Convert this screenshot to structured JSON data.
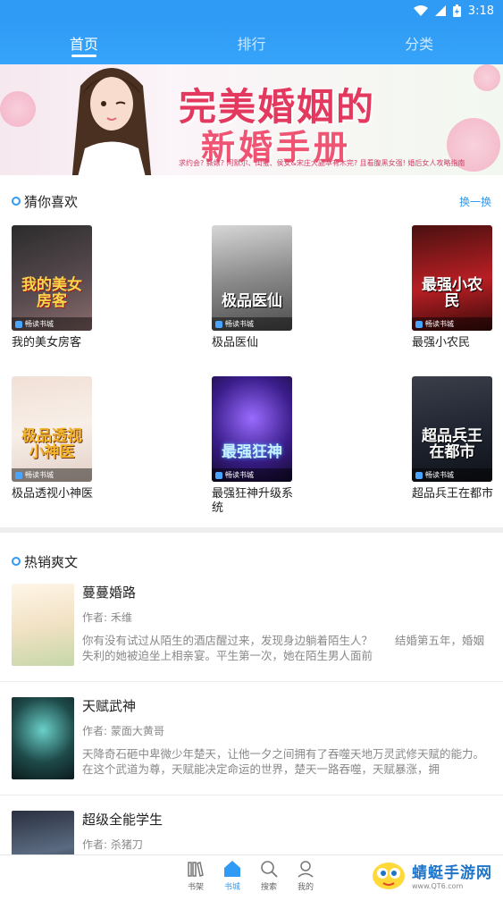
{
  "status_bar": {
    "time": "3:18"
  },
  "top_tabs": [
    {
      "label": "首页",
      "active": true
    },
    {
      "label": "排行",
      "active": false
    },
    {
      "label": "分类",
      "active": false
    }
  ],
  "banner": {
    "title_line1": "完美婚姻的",
    "title_line2": "新婚手册",
    "subtitle": "求约会? 撕婊? 阿默尔、闺蜜、侯女&宋庄大副本有木完? 且看腹黑女强! 婚后女人攻略指南"
  },
  "guess": {
    "title": "猜你喜欢",
    "refresh": "换一换",
    "brand": "畅读书城",
    "books": [
      {
        "name": "我的美女房客",
        "cover_text": "我的美女房客"
      },
      {
        "name": "极品医仙",
        "cover_text": "极品医仙"
      },
      {
        "name": "最强小农民",
        "cover_text": "最强小农民"
      },
      {
        "name": "极品透视小神医",
        "cover_text": "极品透视小神医"
      },
      {
        "name": "最强狂神升级系统",
        "cover_text": "最强狂神"
      },
      {
        "name": "超品兵王在都市",
        "cover_text": "超品兵王在都市"
      }
    ]
  },
  "hot": {
    "title": "热销爽文",
    "author_prefix": "作者: ",
    "items": [
      {
        "title": "蔓蔓婚路",
        "author": "禾维",
        "desc": "你有没有试过从陌生的酒店醒过来，发现身边躺着陌生人？　　结婚第五年，婚姻失利的她被迫坐上相亲宴。平生第一次，她在陌生男人面前"
      },
      {
        "title": "天赋武神",
        "author": "蒙面大黄哥",
        "desc": "天降奇石砸中卑微少年楚天，让他一夕之间拥有了吞噬天地万灵武修天赋的能力。在这个武道为尊，天赋能决定命运的世界，楚天一路吞噬，天赋暴涨，拥"
      },
      {
        "title": "超级全能学生",
        "author": "杀猪刀",
        "desc": ""
      }
    ]
  },
  "bottom_nav": [
    {
      "label": "书架",
      "icon": "bookshelf-icon",
      "active": false
    },
    {
      "label": "书城",
      "icon": "home-icon",
      "active": true
    },
    {
      "label": "搜索",
      "icon": "search-icon",
      "active": false
    },
    {
      "label": "我的",
      "icon": "profile-icon",
      "active": false
    }
  ],
  "watermark": {
    "name": "蜻蜓手游网",
    "url": "www.QT6.com"
  },
  "colors": {
    "accent": "#2f9bf4",
    "text_secondary": "#888888"
  }
}
